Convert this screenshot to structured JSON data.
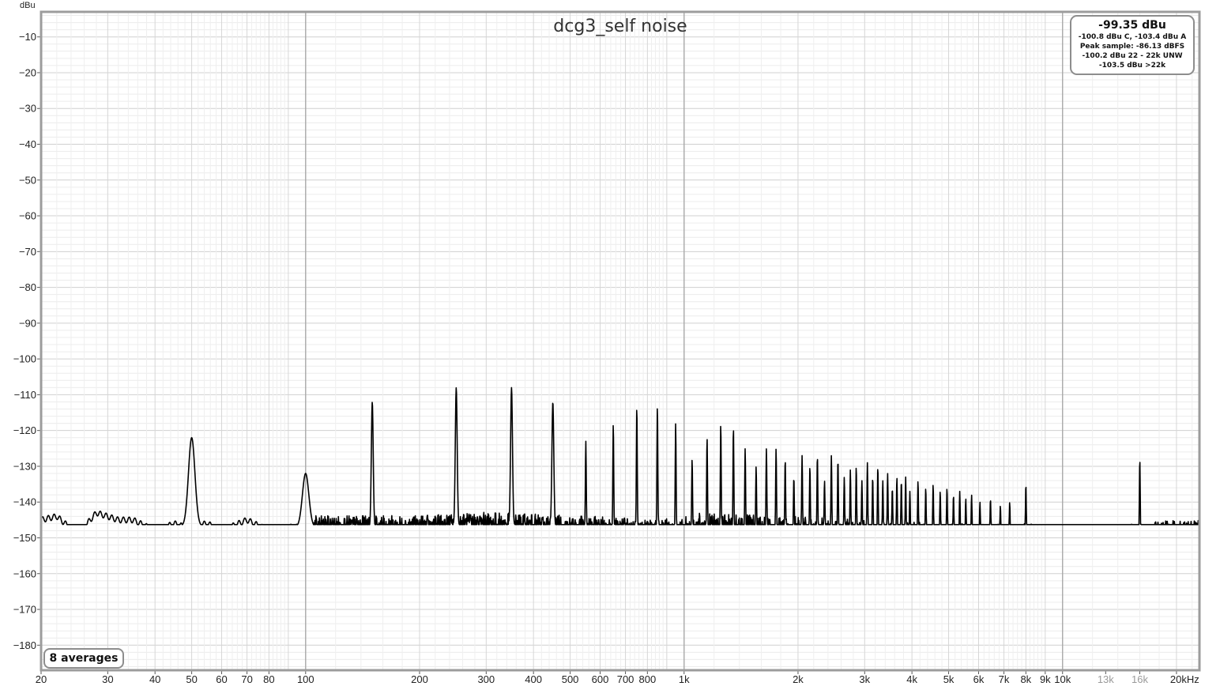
{
  "chart_data": {
    "type": "line",
    "title": "dcg3_self noise",
    "ylabel": "dBu",
    "xlabel": "",
    "x_scale": "log",
    "xlim": [
      20,
      23000
    ],
    "ylim": [
      -187,
      -3
    ],
    "grid": true,
    "x_ticks": [
      {
        "value": 20,
        "label": "20"
      },
      {
        "value": 30,
        "label": "30"
      },
      {
        "value": 40,
        "label": "40"
      },
      {
        "value": 50,
        "label": "50"
      },
      {
        "value": 60,
        "label": "60"
      },
      {
        "value": 70,
        "label": "70"
      },
      {
        "value": 80,
        "label": "80"
      },
      {
        "value": 100,
        "label": "100"
      },
      {
        "value": 200,
        "label": "200"
      },
      {
        "value": 300,
        "label": "300"
      },
      {
        "value": 400,
        "label": "400"
      },
      {
        "value": 500,
        "label": "500"
      },
      {
        "value": 600,
        "label": "600"
      },
      {
        "value": 700,
        "label": "700"
      },
      {
        "value": 800,
        "label": "800"
      },
      {
        "value": 1000,
        "label": "1k"
      },
      {
        "value": 2000,
        "label": "2k"
      },
      {
        "value": 3000,
        "label": "3k"
      },
      {
        "value": 4000,
        "label": "4k"
      },
      {
        "value": 5000,
        "label": "5k"
      },
      {
        "value": 6000,
        "label": "6k"
      },
      {
        "value": 7000,
        "label": "7k"
      },
      {
        "value": 8000,
        "label": "8k"
      },
      {
        "value": 9000,
        "label": "9k"
      },
      {
        "value": 10000,
        "label": "10k"
      },
      {
        "value": 13000,
        "label": "13k",
        "muted": true
      },
      {
        "value": 16000,
        "label": "16k",
        "muted": true
      },
      {
        "value": 20000,
        "label": "20kHz"
      }
    ],
    "y_ticks": [
      -10,
      -20,
      -30,
      -40,
      -50,
      -60,
      -70,
      -80,
      -90,
      -100,
      -110,
      -120,
      -130,
      -140,
      -150,
      -160,
      -170,
      -180
    ],
    "series": [
      {
        "color": "#000000",
        "noise_floor_x": [
          20,
          22,
          25,
          28,
          32,
          35,
          40,
          45,
          48,
          55,
          60,
          70,
          80,
          90,
          100,
          150,
          200,
          300,
          500,
          1000,
          2000,
          3000,
          5000,
          8000,
          10000,
          15000,
          20000,
          23000
        ],
        "noise_floor_y": [
          -145,
          -144,
          -149,
          -143,
          -145,
          -145,
          -148,
          -146,
          -147,
          -146,
          -148,
          -145,
          -148,
          -147,
          -147,
          -147,
          -147,
          -146,
          -147,
          -148,
          -149,
          -150,
          -151,
          -151,
          -152,
          -151,
          -150,
          -150
        ],
        "peaks": [
          {
            "x": 50,
            "y": -122
          },
          {
            "x": 100,
            "y": -132
          },
          {
            "x": 150,
            "y": -112
          },
          {
            "x": 250,
            "y": -108
          },
          {
            "x": 350,
            "y": -108
          },
          {
            "x": 450,
            "y": -112
          },
          {
            "x": 550,
            "y": -123
          },
          {
            "x": 650,
            "y": -118
          },
          {
            "x": 750,
            "y": -113
          },
          {
            "x": 850,
            "y": -113
          },
          {
            "x": 950,
            "y": -118
          },
          {
            "x": 1050,
            "y": -128
          },
          {
            "x": 1150,
            "y": -122
          },
          {
            "x": 1250,
            "y": -118
          },
          {
            "x": 1350,
            "y": -119
          },
          {
            "x": 1450,
            "y": -125
          },
          {
            "x": 1550,
            "y": -130
          },
          {
            "x": 1650,
            "y": -125
          },
          {
            "x": 1750,
            "y": -125
          },
          {
            "x": 1850,
            "y": -128
          },
          {
            "x": 1950,
            "y": -133
          },
          {
            "x": 2050,
            "y": -127
          },
          {
            "x": 2150,
            "y": -130
          },
          {
            "x": 2250,
            "y": -127
          },
          {
            "x": 2350,
            "y": -134
          },
          {
            "x": 2450,
            "y": -127
          },
          {
            "x": 2550,
            "y": -128
          },
          {
            "x": 2650,
            "y": -133
          },
          {
            "x": 2750,
            "y": -131
          },
          {
            "x": 2850,
            "y": -130
          },
          {
            "x": 2950,
            "y": -134
          },
          {
            "x": 3050,
            "y": -129
          },
          {
            "x": 3150,
            "y": -133
          },
          {
            "x": 3250,
            "y": -130
          },
          {
            "x": 3350,
            "y": -134
          },
          {
            "x": 3450,
            "y": -132
          },
          {
            "x": 3550,
            "y": -136
          },
          {
            "x": 3650,
            "y": -133
          },
          {
            "x": 3750,
            "y": -134
          },
          {
            "x": 3850,
            "y": -133
          },
          {
            "x": 3950,
            "y": -137
          },
          {
            "x": 4150,
            "y": -134
          },
          {
            "x": 4350,
            "y": -136
          },
          {
            "x": 4550,
            "y": -135
          },
          {
            "x": 4750,
            "y": -137
          },
          {
            "x": 4950,
            "y": -136
          },
          {
            "x": 5150,
            "y": -138
          },
          {
            "x": 5350,
            "y": -137
          },
          {
            "x": 5550,
            "y": -139
          },
          {
            "x": 5750,
            "y": -138
          },
          {
            "x": 6050,
            "y": -140
          },
          {
            "x": 6450,
            "y": -139
          },
          {
            "x": 6850,
            "y": -141
          },
          {
            "x": 7250,
            "y": -140
          },
          {
            "x": 8000,
            "y": -135
          },
          {
            "x": 16000,
            "y": -128
          }
        ]
      }
    ]
  },
  "stats": {
    "main": "-99.35 dBu",
    "lines": [
      "-100.8 dBu C, -103.4 dBu A",
      "Peak sample: -86.13 dBFS",
      "-100.2 dBu 22 - 22k UNW",
      "-103.5 dBu >22k"
    ]
  },
  "averages_label": "8 averages"
}
